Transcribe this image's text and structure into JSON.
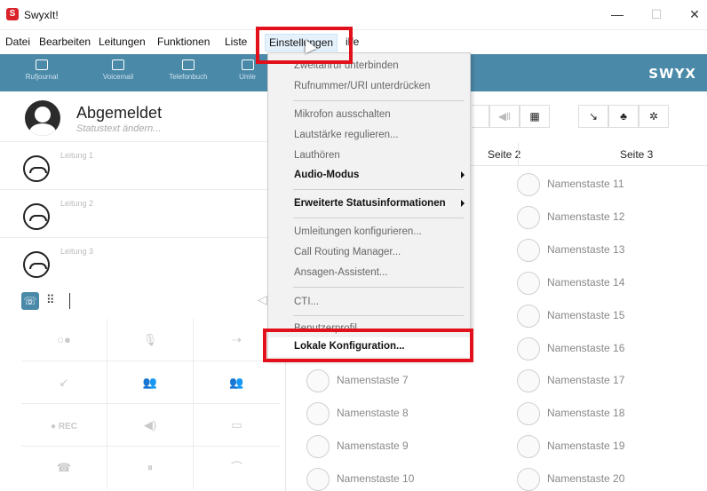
{
  "app": {
    "title": "SwyxIt!",
    "icon_letter": "S"
  },
  "window_controls": {
    "minimize": "—",
    "maximize": "☐",
    "close": "✕"
  },
  "menubar": [
    "Datei",
    "Bearbeiten",
    "Leitungen",
    "Funktionen",
    "Liste",
    "Einstellungen",
    "Hilfe"
  ],
  "menubar_hilfe_visible": "ilfe",
  "toolbar": {
    "buttons": [
      {
        "label": "Rufjournal",
        "icon": "call-journal-icon"
      },
      {
        "label": "Voicemail",
        "icon": "voicemail-icon"
      },
      {
        "label": "Telefonbuch",
        "icon": "phonebook-icon"
      },
      {
        "label": "Umle",
        "icon": "forwarding-icon"
      }
    ],
    "brand": "SWYX"
  },
  "profile": {
    "status": "Abgemeldet",
    "status_text_placeholder": "Statustext ändern..."
  },
  "lines": [
    "Leitung 1",
    "Leitung 2",
    "Leitung 3"
  ],
  "dial": {
    "keypad_icon": "⠿"
  },
  "function_keys": [
    [
      "○●",
      "🎙",
      "⇢"
    ],
    [
      "↙",
      "👥",
      "👥"
    ],
    [
      "● REC",
      "◀)",
      "▭"
    ],
    [
      "☎",
      "⏸",
      "⌒"
    ]
  ],
  "pages": {
    "page2": "Seite 2",
    "page3": "Seite 3"
  },
  "name_keys_col1": [
    "Namenstaste 7",
    "Namenstaste 8",
    "Namenstaste 9",
    "Namenstaste 10"
  ],
  "name_keys_col2": [
    "Namenstaste 11",
    "Namenstaste 12",
    "Namenstaste 13",
    "Namenstaste 14",
    "Namenstaste 15",
    "Namenstaste 16",
    "Namenstaste 17",
    "Namenstaste 18",
    "Namenstaste 19",
    "Namenstaste 20"
  ],
  "dropdown": {
    "items": [
      {
        "label": "Zweitanruf unterbinden",
        "bold": false,
        "submenu": false
      },
      {
        "label": "Rufnummer/URI unterdrücken",
        "bold": false,
        "submenu": false
      },
      {
        "label": "Mikrofon ausschalten",
        "bold": false,
        "submenu": false
      },
      {
        "label": "Lautstärke regulieren...",
        "bold": false,
        "submenu": false
      },
      {
        "label": "Lauthören",
        "bold": false,
        "submenu": false
      },
      {
        "label": "Audio-Modus",
        "bold": true,
        "submenu": true
      },
      {
        "label": "Erweiterte Statusinformationen",
        "bold": true,
        "submenu": true
      },
      {
        "label": "Umleitungen konfigurieren...",
        "bold": false,
        "submenu": false
      },
      {
        "label": "Call Routing Manager...",
        "bold": false,
        "submenu": false
      },
      {
        "label": "Ansagen-Assistent...",
        "bold": false,
        "submenu": false
      },
      {
        "label": "CTI...",
        "bold": false,
        "submenu": false
      },
      {
        "label": "Benutzerprofil...",
        "bold": false,
        "submenu": false
      },
      {
        "label": "Lokale Konfiguration...",
        "bold": true,
        "submenu": false
      }
    ]
  },
  "colors": {
    "toolbar": "#4a89a8",
    "highlight_box": "#e2101a",
    "app_icon": "#d9222a"
  }
}
